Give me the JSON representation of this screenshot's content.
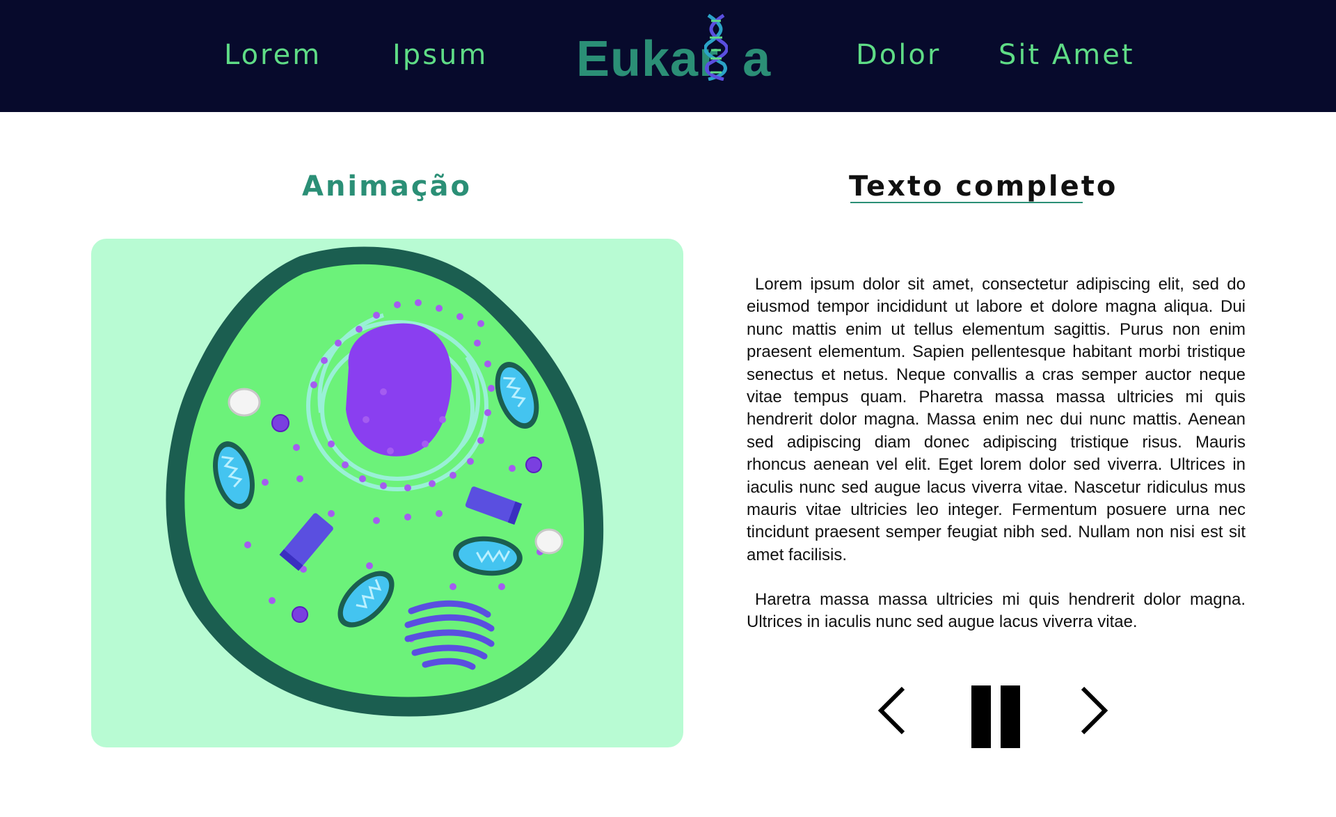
{
  "header": {
    "nav_left": [
      "Lorem",
      "Ipsum"
    ],
    "nav_right": [
      "Dolor",
      "Sit Amet"
    ],
    "logo_text": "Eukar",
    "logo_text_end": "a",
    "logo_icon": "dna-helix-icon",
    "colors": {
      "background": "#070a2c",
      "accent": "#5fdc86",
      "logo": "#2b8f76"
    }
  },
  "animation": {
    "title": "Animação",
    "illustration": "animal-cell-illustration",
    "colors": {
      "panel": "#b8fbd3",
      "membrane": "#1b5e50",
      "cytoplasm": "#6cf27a",
      "nucleus": "#8a3ff0"
    }
  },
  "text_panel": {
    "title": "Texto completo",
    "paragraphs": [
      "Lorem ipsum dolor sit amet, consectetur adipiscing elit, sed do eiusmod tempor incididunt ut labore et dolore magna aliqua. Dui nunc mattis enim ut tellus elementum sagittis. Purus non enim praesent elementum. Sapien pellentesque habitant morbi tristique senectus et netus. Neque convallis a cras semper auctor neque vitae tempus quam. Pharetra massa massa ultricies mi quis hendrerit dolor magna. Massa enim nec dui nunc mattis. Aenean sed adipiscing diam donec adipiscing tristique risus. Mauris rhoncus aenean vel elit. Eget lorem dolor sed viverra. Ultrices in iaculis nunc sed augue lacus viverra vitae. Nascetur ridiculus mus mauris vitae ultricies leo integer. Fermentum posuere urna nec tincidunt praesent semper feugiat nibh sed. Nullam non nisi est sit amet facilisis.",
      "Haretra massa massa ultricies mi quis hendrerit dolor magna. Ultrices in iaculis nunc sed augue lacus viverra vitae."
    ]
  },
  "controls": {
    "prev_icon": "chevron-left-icon",
    "pause_icon": "pause-icon",
    "next_icon": "chevron-right-icon"
  }
}
